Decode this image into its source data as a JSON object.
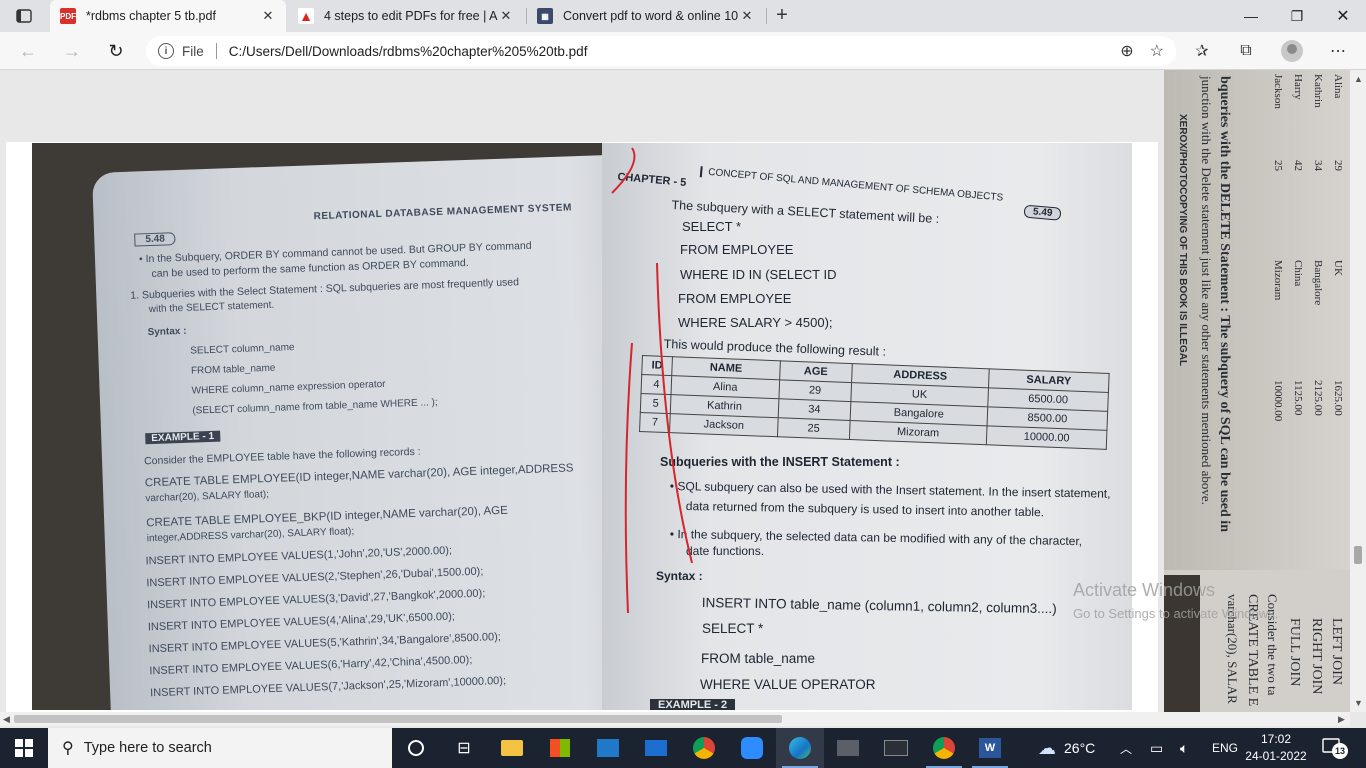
{
  "browser": {
    "tabs": [
      {
        "title": "*rdbms chapter 5 tb.pdf",
        "active": true,
        "favicon": "pdf-icon"
      },
      {
        "title": "4 steps to edit PDFs for free | Ad",
        "active": false,
        "favicon": "adobe-icon"
      },
      {
        "title": "Convert pdf to word & online 10",
        "active": false,
        "favicon": "converter-icon"
      }
    ],
    "address": {
      "scheme_label": "File",
      "url": "C:/Users/Dell/Downloads/rdbms%20chapter%205%20tb.pdf"
    }
  },
  "pdf": {
    "left_page": {
      "page_no": "5.48",
      "header": "RELATIONAL DATABASE MANAGEMENT SYSTEM",
      "lines": [
        "• In the Subquery, ORDER BY command cannot be used. But GROUP BY command",
        "can be used to perform the same function as ORDER BY command.",
        "1. Subqueries with the Select Statement : SQL subqueries are most frequently used",
        "with the SELECT statement.",
        "Syntax :",
        "SELECT column_name",
        "FROM table_name",
        "WHERE column_name expression operator",
        "(SELECT column_name from table_name WHERE ... );",
        "EXAMPLE - 1",
        "Consider the EMPLOYEE table have the following records :",
        "CREATE TABLE EMPLOYEE(ID integer,NAME varchar(20), AGE integer,ADDRESS",
        "varchar(20), SALARY float);",
        "CREATE TABLE EMPLOYEE_BKP(ID integer,NAME varchar(20), AGE",
        "integer,ADDRESS varchar(20), SALARY float);",
        "INSERT INTO EMPLOYEE VALUES(1,'John',20,'US',2000.00);",
        "INSERT INTO EMPLOYEE VALUES(2,'Stephen',26,'Dubai',1500.00);",
        "INSERT INTO EMPLOYEE VALUES(3,'David',27,'Bangkok',2000.00);",
        "INSERT INTO EMPLOYEE VALUES(4,'Alina',29,'UK',6500.00);",
        "INSERT INTO EMPLOYEE VALUES(5,'Kathrin',34,'Bangalore',8500.00);",
        "INSERT INTO EMPLOYEE VALUES(6,'Harry',42,'China',4500.00);",
        "INSERT INTO EMPLOYEE VALUES(7,'Jackson',25,'Mizoram',10000.00);"
      ]
    },
    "right_page": {
      "chapter": "CHAPTER - 5",
      "chapter_title": "CONCEPT OF SQL AND MANAGEMENT OF SCHEMA OBJECTS",
      "page_no": "5.49",
      "intro": "The subquery with a SELECT statement will be :",
      "code": [
        "SELECT *",
        "FROM EMPLOYEE",
        "WHERE ID IN (SELECT ID",
        "FROM EMPLOYEE",
        "WHERE SALARY > 4500);"
      ],
      "result_line": "This would produce the following result :",
      "table": {
        "headers": [
          "ID",
          "NAME",
          "AGE",
          "ADDRESS",
          "SALARY"
        ],
        "rows": [
          [
            "4",
            "Alina",
            "29",
            "UK",
            "6500.00"
          ],
          [
            "5",
            "Kathrin",
            "34",
            "Bangalore",
            "8500.00"
          ],
          [
            "7",
            "Jackson",
            "25",
            "Mizoram",
            "10000.00"
          ]
        ]
      },
      "insert_heading": "Subqueries with the INSERT Statement :",
      "bullets": [
        "SQL subquery can also be used with the Insert statement. In the insert statement,",
        "data returned from the subquery is used to insert into another table.",
        "In the subquery, the selected data can be modified with any of the character,",
        "date functions."
      ],
      "syntax_label": "Syntax :",
      "syntax": [
        "INSERT INTO table_name (column1, column2, column3....)",
        "SELECT *",
        "FROM table_name",
        "WHERE VALUE OPERATOR"
      ],
      "example": "EXAMPLE - 2"
    },
    "side_page": {
      "lines": [
        "bqueries with the DELETE Statement : The subquery of SQL can be used in",
        "junction with the Delete statement just like any other statements mentioned above.",
        "XEROX/PHOTOCOPYING OF THIS BOOK IS ILLEGAL",
        "LEFT JOIN",
        "RIGHT JOIN",
        "FULL JOIN",
        "Consider the two ta",
        "CREATE TABLE E",
        "varchar(20), SALAR"
      ],
      "table_rows": [
        [
          "Alina",
          "29",
          "UK",
          "1625.00"
        ],
        [
          "Kathrin",
          "34",
          "Bangalore",
          "2125.00"
        ],
        [
          "Harry",
          "42",
          "China",
          "1125.00"
        ],
        [
          "Jackson",
          "25",
          "Mizoram",
          "10000.00"
        ]
      ]
    },
    "watermark": {
      "line1": "Activate Windows",
      "line2": "Go to Settings to activate Windows."
    }
  },
  "taskbar": {
    "search_placeholder": "Type here to search",
    "weather": "26°C",
    "language": "ENG",
    "time": "17:02",
    "date": "24-01-2022",
    "notifications": "13"
  }
}
